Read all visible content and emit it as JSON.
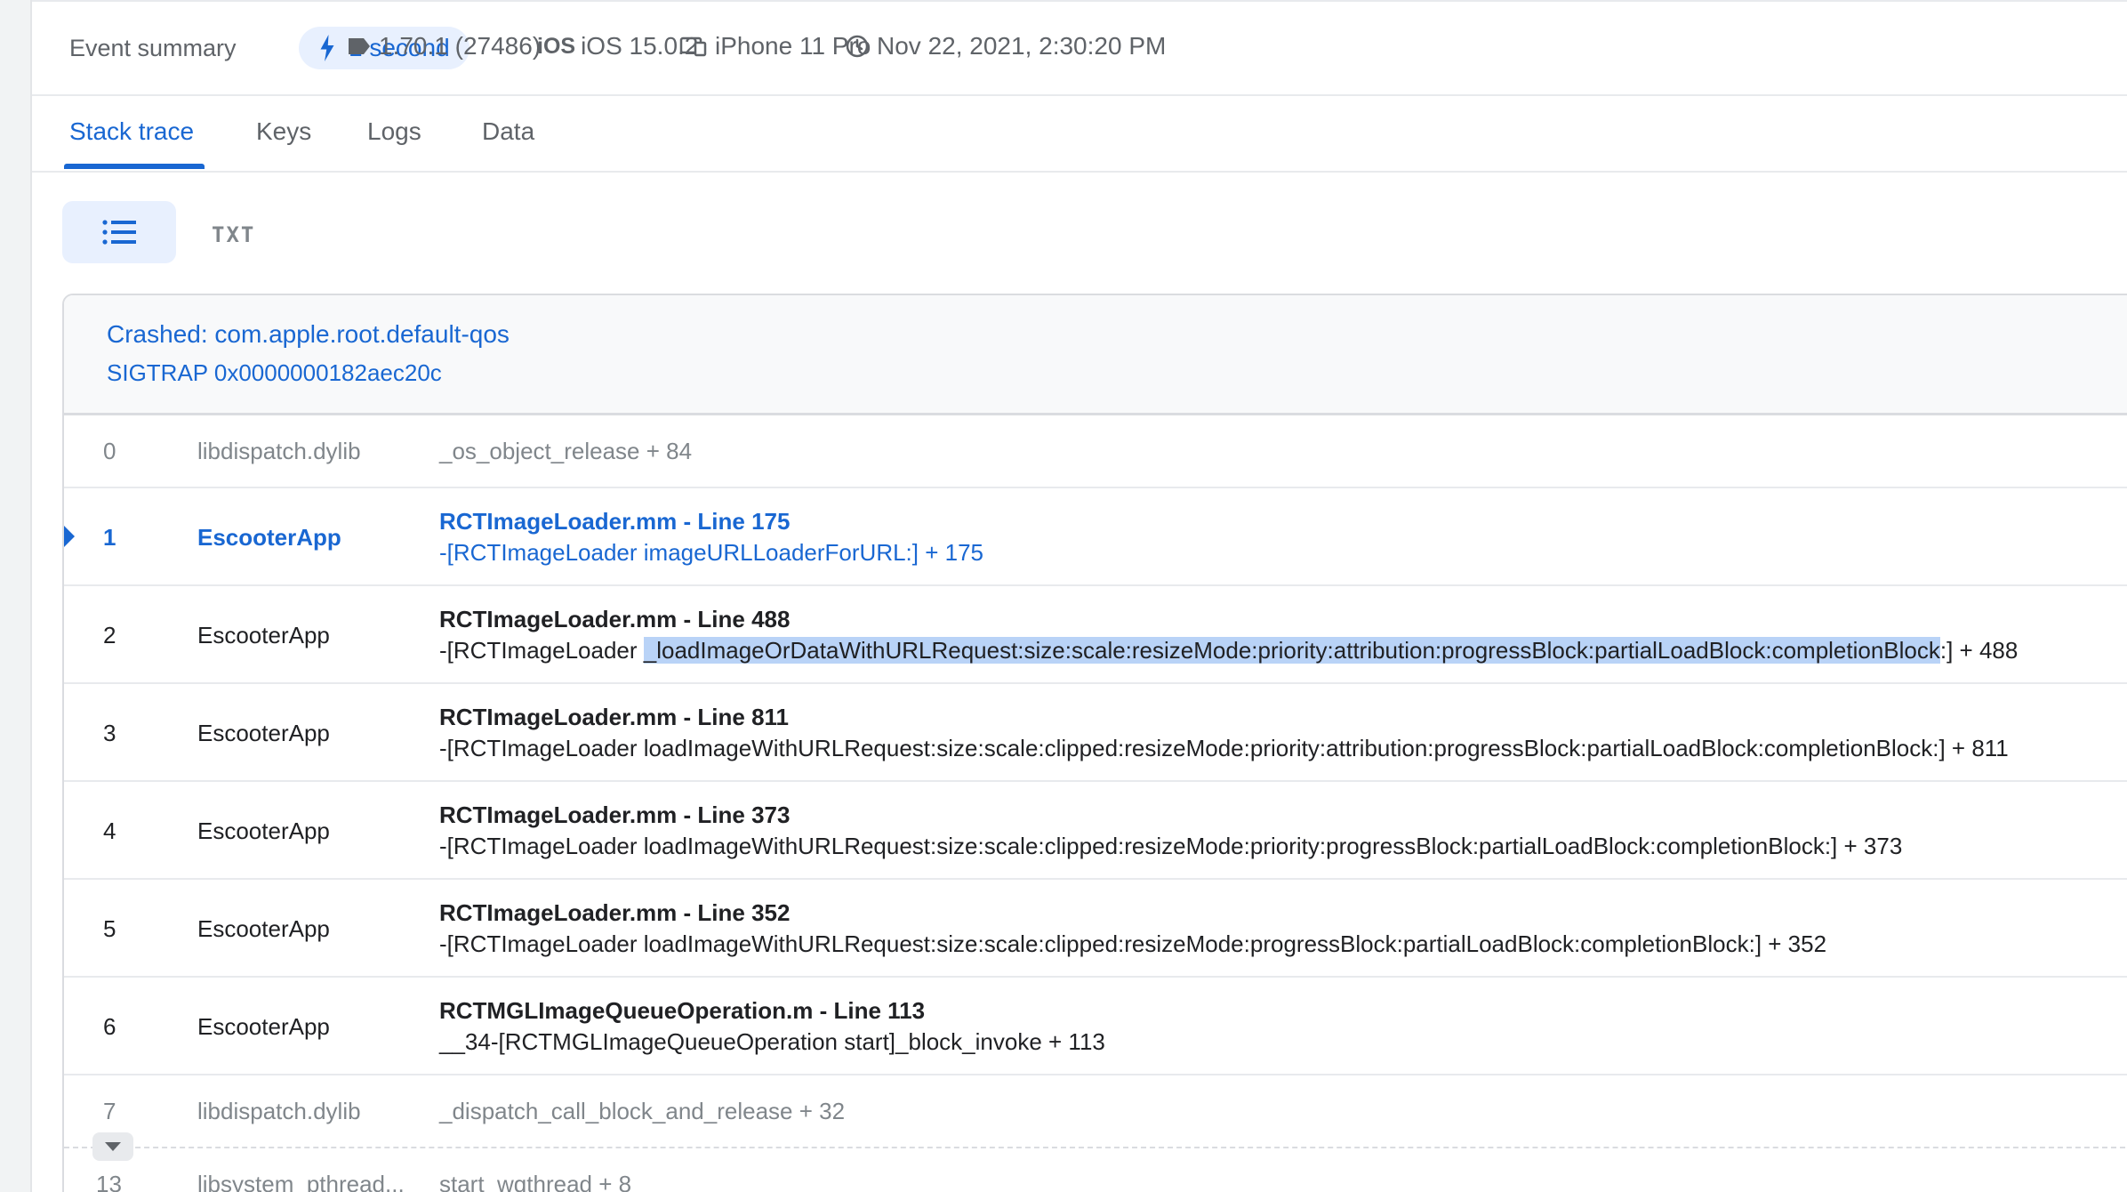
{
  "summary": {
    "label": "Event summary",
    "duration": "1 second",
    "version": "1.70.1 (27486)",
    "os_mark": "iOS",
    "os": "iOS 15.0.2",
    "device": "iPhone 11 Pro",
    "timestamp": "Nov 22, 2021, 2:30:20 PM"
  },
  "tabs": [
    "Stack trace",
    "Keys",
    "Logs",
    "Data"
  ],
  "view": {
    "txt_label": "TXT"
  },
  "crash": {
    "title": "Crashed: com.apple.root.default-qos",
    "signal": "SIGTRAP 0x0000000182aec20c"
  },
  "frames": [
    {
      "num": "0",
      "lib": "libdispatch.dylib",
      "symbol": "_os_object_release + 84"
    },
    {
      "num": "1",
      "lib": "EscooterApp",
      "file": "RCTImageLoader.mm - Line 175",
      "method": "-[RCTImageLoader imageURLLoaderForURL:] + 175"
    },
    {
      "num": "2",
      "lib": "EscooterApp",
      "file": "RCTImageLoader.mm - Line 488",
      "method_pre": "-[RCTImageLoader ",
      "method_hl": "_loadImageOrDataWithURLRequest:size:scale:resizeMode:priority:attribution:progressBlock:partialLoadBlock:completionBlock",
      "method_post": ":] + 488"
    },
    {
      "num": "3",
      "lib": "EscooterApp",
      "file": "RCTImageLoader.mm - Line 811",
      "method": "-[RCTImageLoader loadImageWithURLRequest:size:scale:clipped:resizeMode:priority:attribution:progressBlock:partialLoadBlock:completionBlock:] + 811"
    },
    {
      "num": "4",
      "lib": "EscooterApp",
      "file": "RCTImageLoader.mm - Line 373",
      "method": "-[RCTImageLoader loadImageWithURLRequest:size:scale:clipped:resizeMode:priority:progressBlock:partialLoadBlock:completionBlock:] + 373"
    },
    {
      "num": "5",
      "lib": "EscooterApp",
      "file": "RCTImageLoader.mm - Line 352",
      "method": "-[RCTImageLoader loadImageWithURLRequest:size:scale:clipped:resizeMode:progressBlock:partialLoadBlock:completionBlock:] + 352"
    },
    {
      "num": "6",
      "lib": "EscooterApp",
      "file": "RCTMGLImageQueueOperation.m - Line 113",
      "method": "__34-[RCTMGLImageQueueOperation start]_block_invoke + 113"
    },
    {
      "num": "7",
      "lib": "libdispatch.dylib",
      "symbol": "_dispatch_call_block_and_release + 32"
    },
    {
      "num": "13",
      "lib": "libsystem_pthread...",
      "symbol": "start_wqthread + 8"
    }
  ]
}
